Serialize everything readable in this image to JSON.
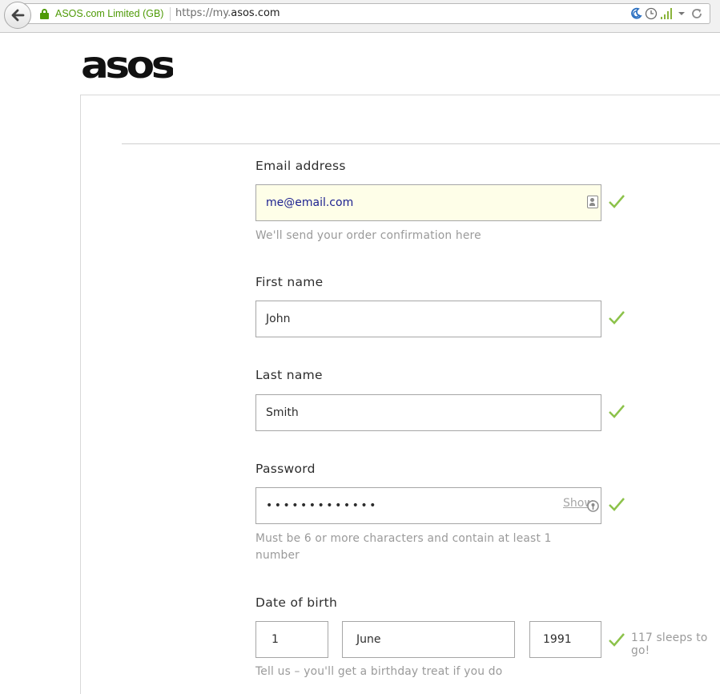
{
  "browser": {
    "identity": "ASOS.com Limited (GB)",
    "url_prefix": "https://my.",
    "url_domain": "asos.com",
    "icons": [
      "back-arrow-icon",
      "lock-icon",
      "moon-icon",
      "clock-icon",
      "signal-bars-icon",
      "dropdown-arrow-icon",
      "reload-icon"
    ]
  },
  "logo": {
    "text": "asos"
  },
  "form": {
    "email": {
      "label": "Email address",
      "value": "me@email.com",
      "hint": "We'll send your order confirmation here"
    },
    "first_name": {
      "label": "First name",
      "value": "John"
    },
    "last_name": {
      "label": "Last name",
      "value": "Smith"
    },
    "password": {
      "label": "Password",
      "value": "•••••••••••••",
      "show_label": "Show",
      "hint": "Must be 6 or more characters and contain at least 1 number"
    },
    "dob": {
      "label": "Date of birth",
      "day": "1",
      "month": "June",
      "year": "1991",
      "countdown": "117 sleeps to go!",
      "hint": "Tell us – you'll get a birthday treat if you do"
    }
  },
  "colors": {
    "check": "#8cc24a",
    "secure": "#4e9a06",
    "autofill_bg": "#fefee8"
  }
}
